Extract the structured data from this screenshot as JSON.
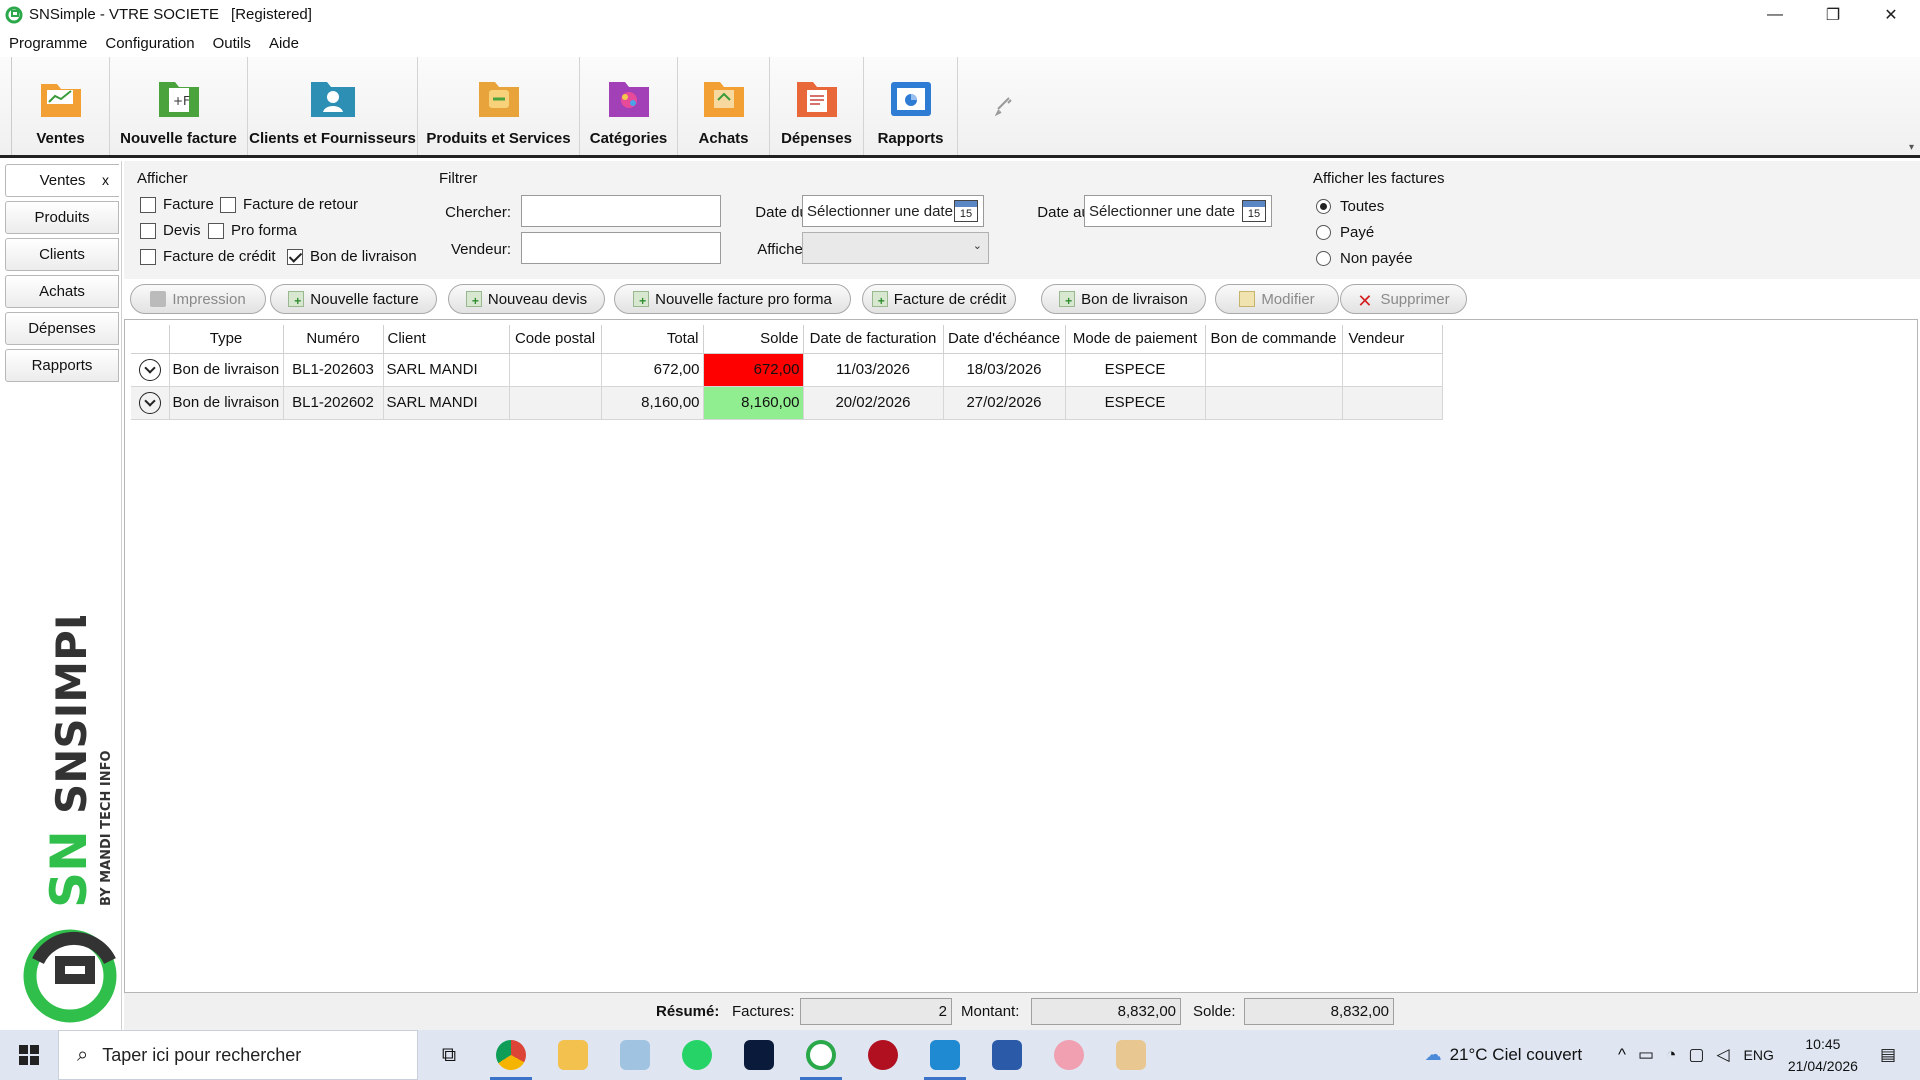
{
  "window": {
    "title": "SNSimple - VTRE SOCIETE",
    "registered": "[Registered]",
    "min_glyph": "—",
    "max_glyph": "❐",
    "close_glyph": "✕"
  },
  "menu": [
    "Programme",
    "Configuration",
    "Outils",
    "Aide"
  ],
  "ribbon": {
    "buttons": [
      {
        "label": "Ventes",
        "icon": "sales-folder-icon"
      },
      {
        "label": "Nouvelle facture",
        "icon": "new-invoice-icon"
      },
      {
        "label": "Clients et Fournisseurs",
        "icon": "clients-folder-icon"
      },
      {
        "label": "Produits et Services",
        "icon": "products-folder-icon"
      },
      {
        "label": "Catégories",
        "icon": "categories-folder-icon"
      },
      {
        "label": "Achats",
        "icon": "purchases-folder-icon"
      },
      {
        "label": "Dépenses",
        "icon": "expenses-folder-icon"
      },
      {
        "label": "Rapports",
        "icon": "reports-icon"
      }
    ],
    "colors": [
      "#f2a033",
      "#4aa33c",
      "#2e8fb5",
      "#e8a43a",
      "#a240b8",
      "#f2a033",
      "#e8683a",
      "#2f7cd4"
    ]
  },
  "sidebar": {
    "tabs": [
      "Ventes",
      "Produits",
      "Clients",
      "Achats",
      "Dépenses",
      "Rapports"
    ],
    "close": "x",
    "logo_text": "SNSIMPLE",
    "logo_sub": "BY MANDI TECH INFO"
  },
  "afficher": {
    "title": "Afficher",
    "facture": "Facture",
    "facture_retour": "Facture de retour",
    "devis": "Devis",
    "pro_forma": "Pro forma",
    "facture_credit": "Facture de crédit",
    "bon_livraison": "Bon de livraison"
  },
  "filtrer": {
    "title": "Filtrer",
    "chercher": "Chercher:",
    "vendeur": "Vendeur:",
    "date_du": "Date du:",
    "date_au": "Date au:",
    "afficher": "Afficher:",
    "date_placeholder": "Sélectionner une date",
    "cal_day": "15"
  },
  "show_invoices": {
    "title": "Afficher les factures",
    "options": [
      "Toutes",
      "Payé",
      "Non payée"
    ]
  },
  "actions": {
    "impression": "Impression",
    "nouvelle_facture": "Nouvelle facture",
    "nouveau_devis": "Nouveau devis",
    "nouvelle_pro_forma": "Nouvelle facture pro forma",
    "facture_credit": "Facture de crédit",
    "bon_livraison": "Bon de livraison",
    "modifier": "Modifier",
    "supprimer": "Supprimer"
  },
  "table": {
    "headers": [
      "",
      "Type",
      "Numéro",
      "Client",
      "Code postal",
      "Total",
      "Solde",
      "Date de facturation",
      "Date d'échéance",
      "Mode de paiement",
      "Bon de commande",
      "Vendeur"
    ],
    "rows": [
      {
        "type": "Bon de livraison",
        "numero": "BL1-202603",
        "client": "SARL MANDI",
        "code_postal": "",
        "total": "672,00",
        "solde": "672,00",
        "date_fact": "11/03/2026",
        "date_ech": "18/03/2026",
        "mode": "ESPECE",
        "bon_cmd": "",
        "vendeur": ""
      },
      {
        "type": "Bon de livraison",
        "numero": "BL1-202602",
        "client": "SARL MANDI",
        "code_postal": "",
        "total": "8,160,00",
        "solde": "8,160,00",
        "date_fact": "20/02/2026",
        "date_ech": "27/02/2026",
        "mode": "ESPECE",
        "bon_cmd": "",
        "vendeur": ""
      }
    ],
    "solde_colors": {
      "unpaid": "#ff0000",
      "paid": "#90ee90"
    }
  },
  "summary": {
    "label": "Résumé:",
    "factures_label": "Factures:",
    "factures_value": "2",
    "montant_label": "Montant:",
    "montant_value": "8,832,00",
    "solde_label": "Solde:",
    "solde_value": "8,832,00"
  },
  "taskbar": {
    "search_placeholder": "Taper ici pour rechercher",
    "weather": "21°C  Ciel couvert",
    "lang": "ENG",
    "time": "10:45",
    "date": "21/04/2026"
  }
}
